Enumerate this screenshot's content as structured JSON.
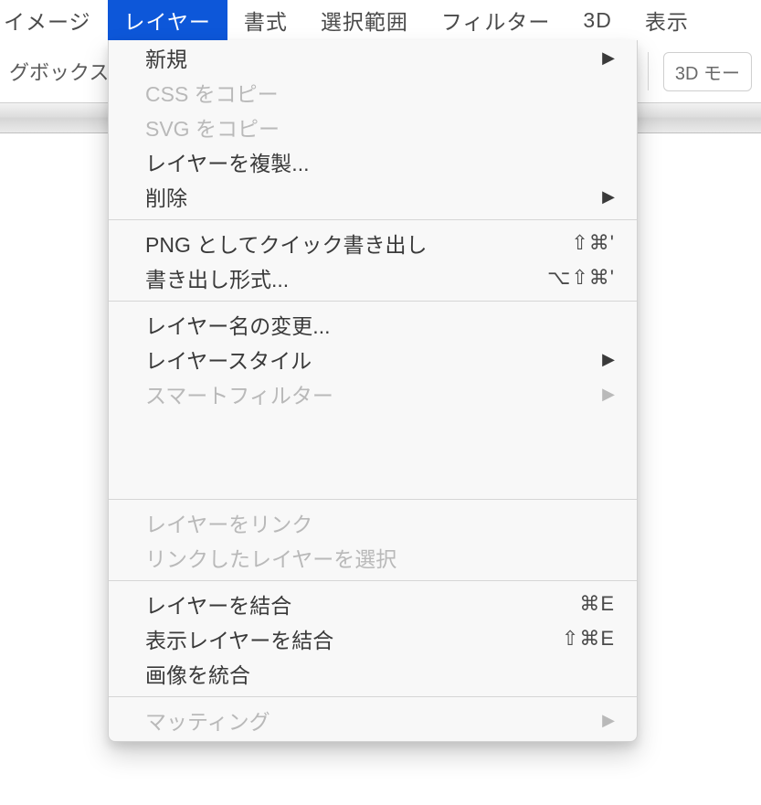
{
  "menubar": {
    "items": [
      {
        "label": "イメージ",
        "partialLeft": true
      },
      {
        "label": "レイヤー",
        "active": true
      },
      {
        "label": "書式"
      },
      {
        "label": "選択範囲"
      },
      {
        "label": "フィルター"
      },
      {
        "label": "3D"
      },
      {
        "label": "表示"
      }
    ]
  },
  "toolbar": {
    "left_text_fragment": "グボックスを",
    "mode_label": "3D モー"
  },
  "dropdown": {
    "groups": [
      [
        {
          "label": "新規",
          "submenu": true
        },
        {
          "label": "CSS をコピー",
          "disabled": true
        },
        {
          "label": "SVG をコピー",
          "disabled": true
        },
        {
          "label": "レイヤーを複製..."
        },
        {
          "label": "削除",
          "submenu": true
        }
      ],
      [
        {
          "label": "PNG としてクイック書き出し",
          "shortcut": "⇧⌘'"
        },
        {
          "label": "書き出し形式...",
          "shortcut": "⌥⇧⌘'"
        }
      ],
      [
        {
          "label": "レイヤー名の変更..."
        },
        {
          "label": "レイヤースタイル",
          "submenu": true
        },
        {
          "label": "スマートフィルター",
          "submenu": true,
          "disabled": true
        }
      ],
      "GAP",
      [
        {
          "label": "レイヤーをリンク",
          "disabled": true
        },
        {
          "label": "リンクしたレイヤーを選択",
          "disabled": true
        }
      ],
      [
        {
          "label": "レイヤーを結合",
          "shortcut": "⌘E"
        },
        {
          "label": "表示レイヤーを結合",
          "shortcut": "⇧⌘E"
        },
        {
          "label": "画像を統合"
        }
      ],
      [
        {
          "label": "マッティング",
          "submenu": true,
          "disabled": true
        }
      ]
    ]
  }
}
